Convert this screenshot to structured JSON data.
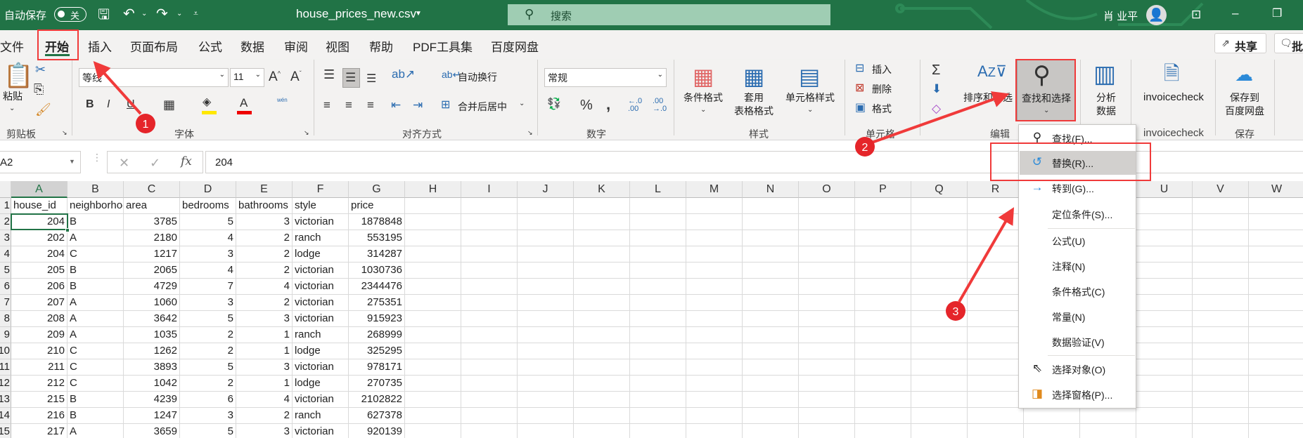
{
  "titlebar": {
    "autosave_label": "自动保存",
    "autosave_state": "关",
    "filename": "house_prices_new.csv",
    "search_placeholder": "搜索",
    "user_name": "肖 业平"
  },
  "tabs": [
    "文件",
    "开始",
    "插入",
    "页面布局",
    "公式",
    "数据",
    "审阅",
    "视图",
    "帮助",
    "PDF工具集",
    "百度网盘"
  ],
  "active_tab": "开始",
  "share_label": "共享",
  "comment_label": "批",
  "ribbon": {
    "clipboard": {
      "paste": "粘贴",
      "group": "剪贴板"
    },
    "font": {
      "name": "等线",
      "size": "11",
      "group": "字体",
      "bold": "B",
      "italic": "I",
      "underline": "U",
      "phonetic": "wén"
    },
    "alignment": {
      "wrap": "自动换行",
      "merge": "合并后居中",
      "group": "对齐方式"
    },
    "number": {
      "format": "常规",
      "group": "数字"
    },
    "styles": {
      "conditional": "条件格式",
      "table1": "套用",
      "table2": "表格格式",
      "cell_styles": "单元格样式",
      "group": "样式"
    },
    "cells": {
      "insert": "插入",
      "delete": "删除",
      "format": "格式",
      "group": "单元格"
    },
    "editing": {
      "sort": "排序和筛选",
      "find": "查找和选择",
      "group": "编辑"
    },
    "analysis": {
      "label1": "分析",
      "label2": "数据"
    },
    "invoicecheck": {
      "label": "invoicecheck",
      "group": "invoicecheck"
    },
    "save": {
      "label1": "保存到",
      "label2": "百度网盘",
      "group": "保存"
    }
  },
  "formula_bar": {
    "name_box": "A2",
    "formula": "204",
    "fx": "fx"
  },
  "columns": [
    "A",
    "B",
    "C",
    "D",
    "E",
    "F",
    "G",
    "H",
    "I",
    "J",
    "K",
    "L",
    "M",
    "N",
    "O",
    "P",
    "Q",
    "R",
    "S",
    "T",
    "U",
    "V",
    "W"
  ],
  "row_numbers": [
    "1",
    "2",
    "3",
    "4",
    "5",
    "6",
    "7",
    "8",
    "9",
    "10",
    "11",
    "12",
    "13",
    "14",
    "15"
  ],
  "headers": [
    "house_id",
    "neighborhood",
    "area",
    "bedrooms",
    "bathrooms",
    "style",
    "price"
  ],
  "rows": [
    [
      "204",
      "B",
      "3785",
      "5",
      "3",
      "victorian",
      "1878848"
    ],
    [
      "202",
      "A",
      "2180",
      "4",
      "2",
      "ranch",
      "553195"
    ],
    [
      "204",
      "C",
      "1217",
      "3",
      "2",
      "lodge",
      "314287"
    ],
    [
      "205",
      "B",
      "2065",
      "4",
      "2",
      "victorian",
      "1030736"
    ],
    [
      "206",
      "B",
      "4729",
      "7",
      "4",
      "victorian",
      "2344476"
    ],
    [
      "207",
      "A",
      "1060",
      "3",
      "2",
      "victorian",
      "275351"
    ],
    [
      "208",
      "A",
      "3642",
      "5",
      "3",
      "victorian",
      "915923"
    ],
    [
      "209",
      "A",
      "1035",
      "2",
      "1",
      "ranch",
      "268999"
    ],
    [
      "210",
      "C",
      "1262",
      "2",
      "1",
      "lodge",
      "325295"
    ],
    [
      "211",
      "C",
      "3893",
      "5",
      "3",
      "victorian",
      "978171"
    ],
    [
      "212",
      "C",
      "1042",
      "2",
      "1",
      "lodge",
      "270735"
    ],
    [
      "215",
      "B",
      "4239",
      "6",
      "4",
      "victorian",
      "2102822"
    ],
    [
      "216",
      "B",
      "1247",
      "3",
      "2",
      "ranch",
      "627378"
    ],
    [
      "217",
      "A",
      "3659",
      "5",
      "3",
      "victorian",
      "920139"
    ]
  ],
  "menu": [
    {
      "label": "查找(F)...",
      "icon": "search-icon"
    },
    {
      "label": "替换(R)...",
      "icon": "replace-icon"
    },
    {
      "label": "转到(G)...",
      "icon": "arrow-right-icon"
    },
    {
      "label": "定位条件(S)..."
    },
    {
      "label": "公式(U)"
    },
    {
      "label": "注释(N)"
    },
    {
      "label": "条件格式(C)"
    },
    {
      "label": "常量(N)"
    },
    {
      "label": "数据验证(V)"
    },
    {
      "label": "选择对象(O)",
      "icon": "pointer-icon"
    },
    {
      "label": "选择窗格(P)...",
      "icon": "selection-pane-icon"
    }
  ],
  "annotations": [
    "1",
    "2",
    "3"
  ],
  "colors": {
    "excel_green": "#217346",
    "annotation_red": "#f03a3a",
    "highlight": "#d2d0ce"
  }
}
